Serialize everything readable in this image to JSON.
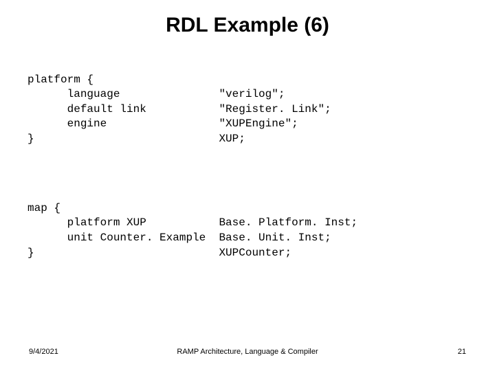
{
  "title": "RDL Example (6)",
  "code": {
    "block1": {
      "l1": "platform {",
      "l2": "      language               \"verilog\";",
      "l3": "      default link           \"Register. Link\";",
      "l4": "      engine                 \"XUPEngine\";",
      "l5": "}                            XUP;"
    },
    "block2": {
      "l1": "map {",
      "l2": "      platform XUP           Base. Platform. Inst;",
      "l3": "      unit Counter. Example  Base. Unit. Inst;",
      "l4": "}                            XUPCounter;"
    }
  },
  "footer": {
    "date": "9/4/2021",
    "center": "RAMP Architecture, Language & Compiler",
    "page": "21"
  }
}
